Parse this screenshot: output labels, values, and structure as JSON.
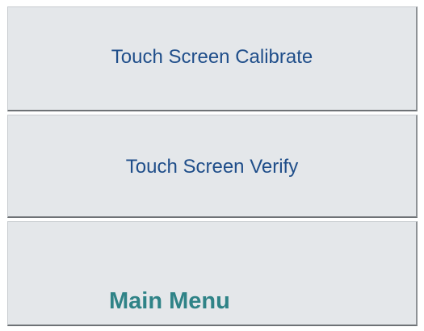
{
  "menu": {
    "buttons": [
      {
        "label": "Touch Screen Calibrate"
      },
      {
        "label": "Touch Screen Verify"
      },
      {
        "label": "Main Menu"
      }
    ]
  },
  "colors": {
    "button_face": "#e4e7ea",
    "label_text": "#1f4e8a",
    "main_menu_text": "#2f8387",
    "border_shadow": "#6e7276"
  }
}
